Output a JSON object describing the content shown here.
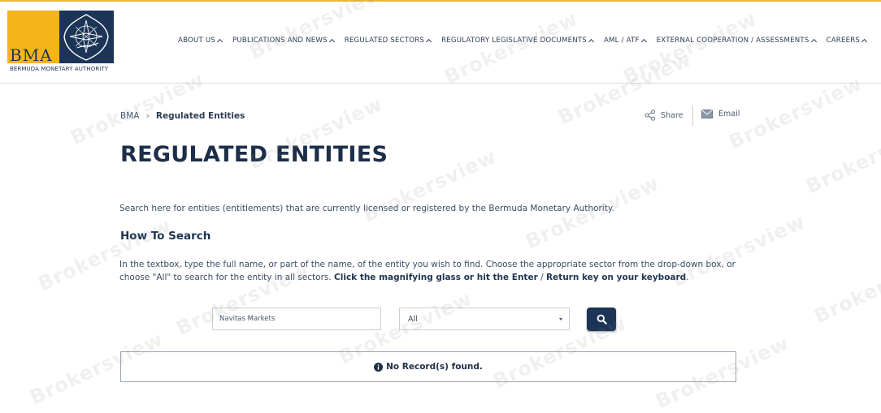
{
  "logo": {
    "abbr": "BMA",
    "name": "BERMUDA MONETARY AUTHORITY"
  },
  "nav": [
    {
      "label": "ABOUT US"
    },
    {
      "label": "PUBLICATIONS AND NEWS"
    },
    {
      "label": "REGULATED SECTORS"
    },
    {
      "label": "REGULATORY LEGISLATIVE DOCUMENTS"
    },
    {
      "label": "AML / ATF"
    },
    {
      "label": "EXTERNAL COOPERATION / ASSESSMENTS"
    },
    {
      "label": "CAREERS"
    }
  ],
  "breadcrumb": {
    "home": "BMA",
    "current": "Regulated Entities"
  },
  "actions": {
    "share": "Share",
    "email": "Email"
  },
  "page": {
    "title": "REGULATED ENTITIES",
    "intro": "Search here for entities (entitlements) that are currently licensed or registered by the Bermuda Monetary Authority.",
    "howto_heading": "How To Search",
    "instructions_plain": "In the textbox, type the full name, or part of the name, of the entity you wish to find. Choose the appropriate sector from the drop-down box, or choose \"All\" to search for the entity in all sectors. ",
    "instructions_bold_1": "Click the magnifying glass or hit the Enter",
    "instructions_slash": " / ",
    "instructions_bold_2": "Return key on your keyboard",
    "instructions_end": "."
  },
  "search": {
    "value": "Navitas Markets",
    "sector_selected": "All"
  },
  "result": {
    "message": "No Record(s) found."
  },
  "watermark": "Brokersview",
  "colors": {
    "brand_navy": "#1c3557",
    "brand_gold": "#f4b41a",
    "top_rule": "#e8b938"
  }
}
